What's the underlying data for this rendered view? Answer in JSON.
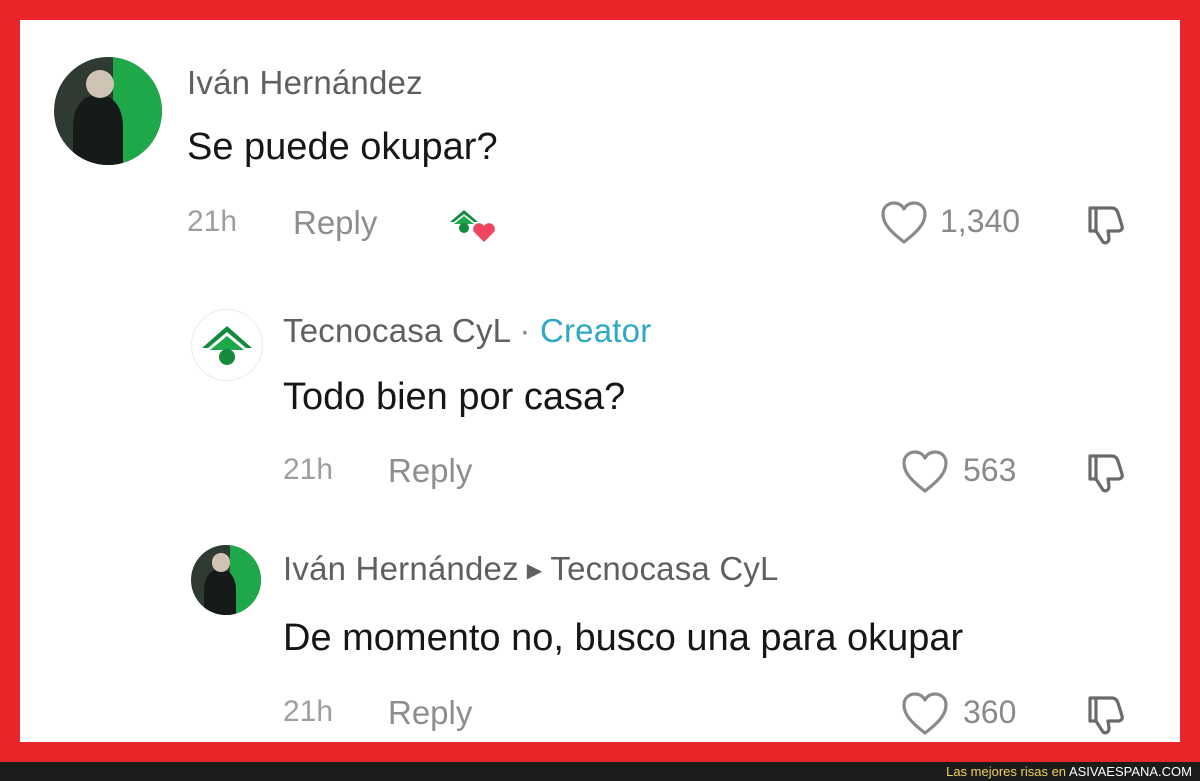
{
  "comments": [
    {
      "author": "Iván Hernández",
      "text": "Se puede okupar?",
      "time": "21h",
      "reply_label": "Reply",
      "likes": "1,340"
    },
    {
      "author": "Tecnocasa CyL",
      "separator": "·",
      "badge": "Creator",
      "text": "Todo bien por casa?",
      "time": "21h",
      "reply_label": "Reply",
      "likes": "563"
    },
    {
      "author": "Iván Hernández",
      "reply_to": "Tecnocasa CyL",
      "text": "De momento no, busco una para okupar",
      "time": "21h",
      "reply_label": "Reply",
      "likes": "360"
    }
  ],
  "footer": {
    "text": "Las mejores risas en ",
    "brand": "ASIVAESPANA.COM"
  },
  "colors": {
    "frame": "#e8262a",
    "creator_badge": "#2fa8c6",
    "logo_green": "#138a3c",
    "heart_red": "#f0455e"
  },
  "icons": {
    "like": "heart-outline-icon",
    "dislike": "thumbs-down-icon",
    "creator_liked": "creator-liked-heart-icon",
    "reply_arrow": "triangle-right-icon"
  }
}
